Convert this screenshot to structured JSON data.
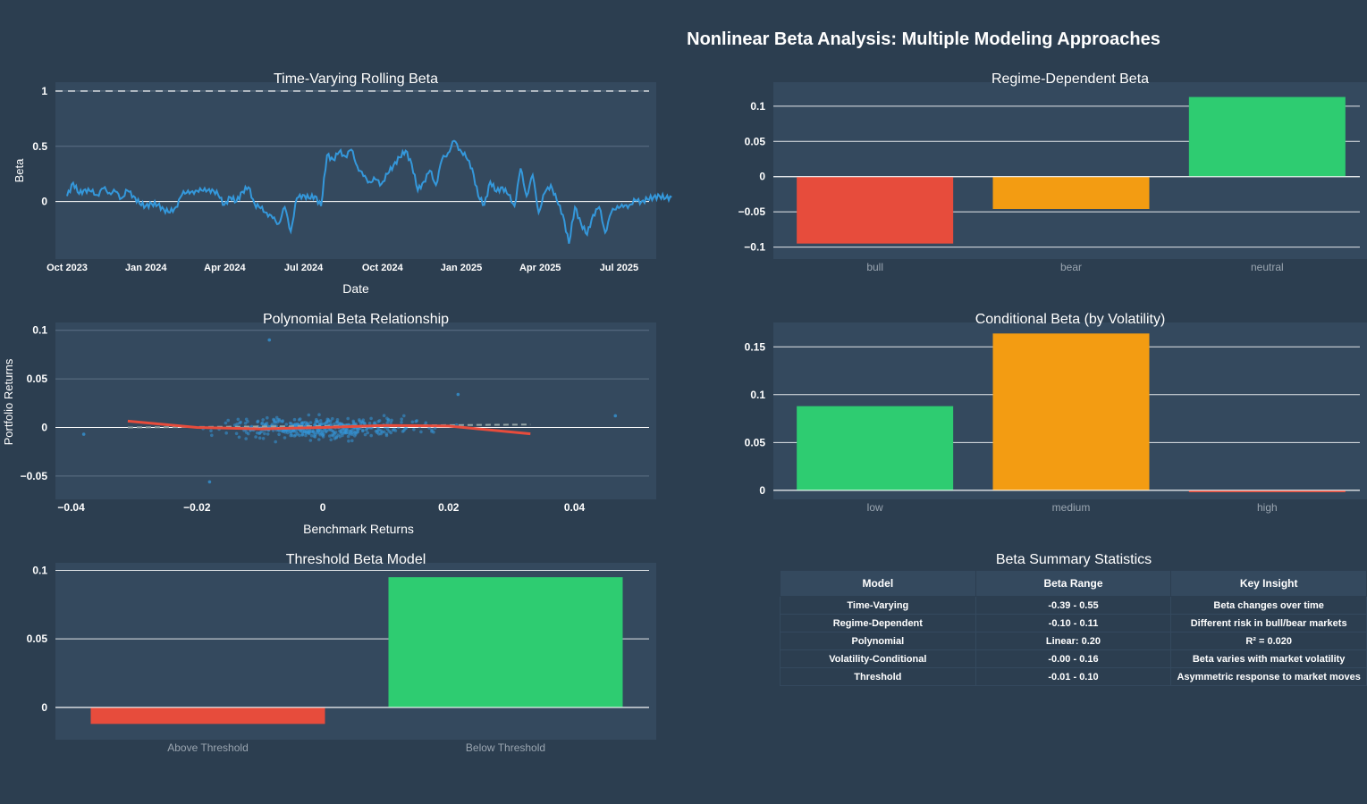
{
  "title": "Nonlinear Beta Analysis: Multiple Modeling Approaches",
  "colors": {
    "background": "#2c3e50",
    "plot_bg": "#34495e",
    "line": "#3498db",
    "red": "#e74c3c",
    "orange": "#f39c12",
    "green": "#2ecc71"
  },
  "chart_data": [
    {
      "id": "rolling",
      "type": "line",
      "title": "Time-Varying Rolling Beta",
      "xlabel": "Date",
      "ylabel": "Beta",
      "x_ticks": [
        "Oct 2023",
        "Jan 2024",
        "Apr 2024",
        "Jul 2024",
        "Oct 2024",
        "Jan 2025",
        "Apr 2025",
        "Jul 2025"
      ],
      "y_ticks": [
        "0",
        "0.5",
        "1"
      ],
      "ylim": [
        -0.52,
        1.08
      ],
      "reference_line": 1,
      "series": [
        {
          "x": [
            "2023-10-01",
            "2023-10-08",
            "2023-10-15",
            "2023-10-22",
            "2023-10-29",
            "2023-11-05",
            "2023-11-12",
            "2023-11-19",
            "2023-11-26",
            "2023-12-03",
            "2023-12-10",
            "2023-12-17",
            "2023-12-24",
            "2023-12-31",
            "2024-01-07",
            "2024-01-14",
            "2024-01-21",
            "2024-01-28",
            "2024-02-04",
            "2024-02-11",
            "2024-02-18",
            "2024-02-25",
            "2024-03-03",
            "2024-03-10",
            "2024-03-17",
            "2024-03-24",
            "2024-03-31",
            "2024-04-07",
            "2024-04-14",
            "2024-04-21",
            "2024-04-28",
            "2024-05-05",
            "2024-05-12",
            "2024-05-19",
            "2024-05-26",
            "2024-06-02",
            "2024-06-09",
            "2024-06-16",
            "2024-06-23",
            "2024-06-30",
            "2024-07-07",
            "2024-07-14",
            "2024-07-21",
            "2024-07-28",
            "2024-08-04",
            "2024-08-11",
            "2024-08-18",
            "2024-08-25",
            "2024-09-01",
            "2024-09-08",
            "2024-09-15",
            "2024-09-22",
            "2024-09-29",
            "2024-10-06",
            "2024-10-13",
            "2024-10-20",
            "2024-10-27",
            "2024-11-03",
            "2024-11-10",
            "2024-11-17",
            "2024-11-24",
            "2024-12-01",
            "2024-12-08",
            "2024-12-15",
            "2024-12-22",
            "2024-12-29",
            "2025-01-05",
            "2025-01-12",
            "2025-01-19",
            "2025-01-26",
            "2025-02-02",
            "2025-02-09",
            "2025-02-16",
            "2025-02-23",
            "2025-03-02",
            "2025-03-09",
            "2025-03-16",
            "2025-03-23",
            "2025-03-30",
            "2025-04-06",
            "2025-04-13",
            "2025-04-20",
            "2025-04-27",
            "2025-05-04",
            "2025-05-11",
            "2025-05-18",
            "2025-05-25",
            "2025-06-01",
            "2025-06-08",
            "2025-06-15",
            "2025-06-22",
            "2025-06-29",
            "2025-07-06",
            "2025-07-13",
            "2025-07-20",
            "2025-07-27",
            "2025-08-03",
            "2025-08-10",
            "2025-08-17",
            "2025-08-24",
            "2025-08-31"
          ],
          "y": [
            0.05,
            0.17,
            0.07,
            0.11,
            0.09,
            0.06,
            0.12,
            0.08,
            0.09,
            0.03,
            0.1,
            0.05,
            -0.02,
            -0.04,
            -0.02,
            -0.03,
            -0.07,
            -0.1,
            -0.05,
            0.06,
            0.1,
            0.07,
            0.12,
            0.09,
            0.11,
            0.06,
            -0.03,
            0.04,
            0.0,
            0.09,
            0.13,
            -0.02,
            -0.06,
            -0.1,
            -0.15,
            -0.2,
            -0.05,
            -0.27,
            0.03,
            0.06,
            0.03,
            0.05,
            -0.04,
            0.42,
            0.38,
            0.45,
            0.41,
            0.47,
            0.32,
            0.23,
            0.18,
            0.2,
            0.16,
            0.25,
            0.33,
            0.4,
            0.46,
            0.34,
            0.1,
            0.18,
            0.28,
            0.15,
            0.38,
            0.44,
            0.55,
            0.47,
            0.4,
            0.3,
            0.05,
            -0.03,
            0.18,
            0.09,
            0.13,
            0.06,
            -0.04,
            0.3,
            0.05,
            0.24,
            -0.1,
            0.08,
            0.15,
            0.01,
            -0.12,
            -0.38,
            -0.05,
            -0.2,
            -0.3,
            -0.12,
            -0.05,
            -0.28,
            -0.1,
            -0.04,
            -0.05,
            -0.03,
            0.01,
            0.0,
            0.02,
            0.04,
            0.05,
            0.03,
            0.04
          ]
        }
      ]
    },
    {
      "id": "regime",
      "type": "bar",
      "title": "Regime-Dependent Beta",
      "categories": [
        "bull",
        "bear",
        "neutral"
      ],
      "values": [
        -0.095,
        -0.046,
        0.113
      ],
      "bar_colors": [
        "#e74c3c",
        "#f39c12",
        "#2ecc71"
      ],
      "y_ticks": [
        "−0.1",
        "−0.05",
        "0",
        "0.05",
        "0.1"
      ],
      "ylim": [
        -0.117,
        0.134
      ]
    },
    {
      "id": "poly",
      "type": "scatter",
      "title": "Polynomial Beta Relationship",
      "xlabel": "Benchmark Returns",
      "ylabel": "Portfolio Returns",
      "x_ticks": [
        "−0.04",
        "−0.02",
        "0",
        "0.02",
        "0.04"
      ],
      "y_ticks": [
        "−0.05",
        "0",
        "0.05",
        "0.1"
      ],
      "xlim": [
        -0.0425,
        0.053
      ],
      "ylim": [
        -0.074,
        0.108
      ],
      "outliers": [
        {
          "x": -0.0085,
          "y": 0.09
        },
        {
          "x": 0.0465,
          "y": 0.012
        },
        {
          "x": -0.038,
          "y": -0.007
        },
        {
          "x": -0.018,
          "y": -0.056
        },
        {
          "x": 0.0215,
          "y": 0.034
        }
      ],
      "fit_curve": {
        "x": [
          -0.031,
          -0.02,
          -0.01,
          0.0,
          0.01,
          0.02,
          0.033
        ],
        "y": [
          0.0065,
          0.0,
          -0.0015,
          0.0,
          0.002,
          0.0015,
          -0.0065
        ]
      },
      "linear_fit": {
        "x": [
          -0.031,
          0.033
        ],
        "y": [
          0.0,
          0.003
        ]
      }
    },
    {
      "id": "conditional",
      "type": "bar",
      "title": "Conditional Beta (by Volatility)",
      "categories": [
        "low",
        "medium",
        "high"
      ],
      "values": [
        0.088,
        0.164,
        -0.002
      ],
      "bar_colors": [
        "#2ecc71",
        "#f39c12",
        "#e74c3c"
      ],
      "y_ticks": [
        "0",
        "0.05",
        "0.1",
        "0.15"
      ],
      "ylim": [
        -0.0095,
        0.1755
      ]
    },
    {
      "id": "threshold",
      "type": "bar",
      "title": "Threshold Beta Model",
      "categories": [
        "Above Threshold",
        "Below Threshold"
      ],
      "values": [
        -0.012,
        0.095
      ],
      "bar_colors": [
        "#e74c3c",
        "#2ecc71"
      ],
      "y_ticks": [
        "0",
        "0.05",
        "0.1"
      ],
      "ylim": [
        -0.0235,
        0.1055
      ]
    }
  ],
  "summary_table": {
    "title": "Beta Summary Statistics",
    "headers": [
      "Model",
      "Beta Range",
      "Key Insight"
    ],
    "rows": [
      [
        "Time-Varying",
        "-0.39 - 0.55",
        "Beta changes over time"
      ],
      [
        "Regime-Dependent",
        "-0.10 - 0.11",
        "Different risk in bull/bear markets"
      ],
      [
        "Polynomial",
        "Linear: 0.20",
        "R² = 0.020"
      ],
      [
        "Volatility-Conditional",
        "-0.00 - 0.16",
        "Beta varies with market volatility"
      ],
      [
        "Threshold",
        "-0.01 - 0.10",
        "Asymmetric response to market moves"
      ]
    ]
  }
}
